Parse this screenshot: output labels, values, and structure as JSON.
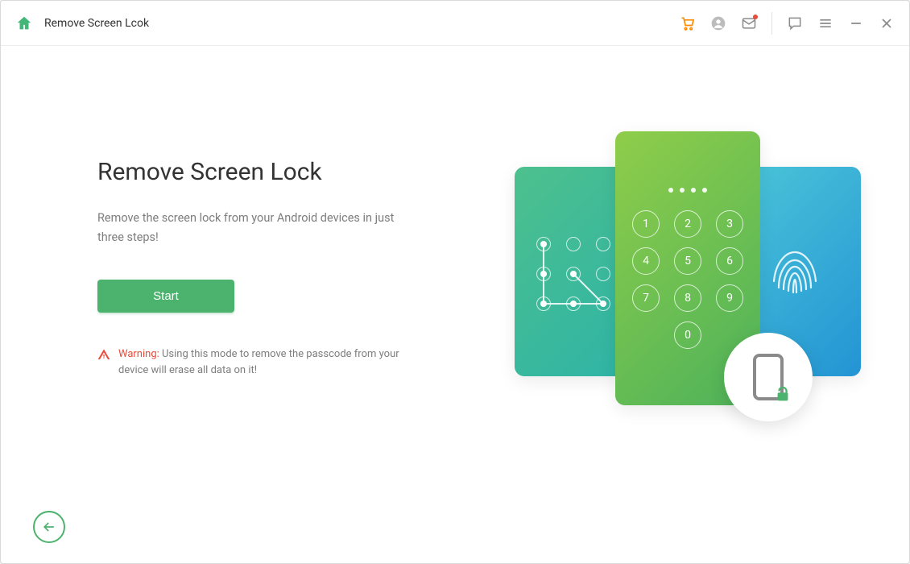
{
  "titlebar": {
    "title": "Remove Screen Lcok",
    "icons": {
      "home": "home-icon",
      "cart": "cart-icon",
      "user": "user-icon",
      "mail": "mail-icon",
      "feedback": "feedback-icon",
      "menu": "menu-icon",
      "minimize": "minimize-icon",
      "close": "close-icon"
    }
  },
  "main": {
    "heading": "Remove Screen Lock",
    "subtext": "Remove the screen lock from your Android devices in just three steps!",
    "start_label": "Start",
    "warning_label": "Warning:",
    "warning_text": " Using this mode to remove the passcode from your device will erase all data on it!"
  },
  "keypad": [
    "1",
    "2",
    "3",
    "4",
    "5",
    "6",
    "7",
    "8",
    "9",
    "0"
  ],
  "footer": {
    "back_label": "Back"
  },
  "colors": {
    "accent": "#4cb36e",
    "warn": "#e74c3c",
    "cart": "#ff8a00"
  }
}
